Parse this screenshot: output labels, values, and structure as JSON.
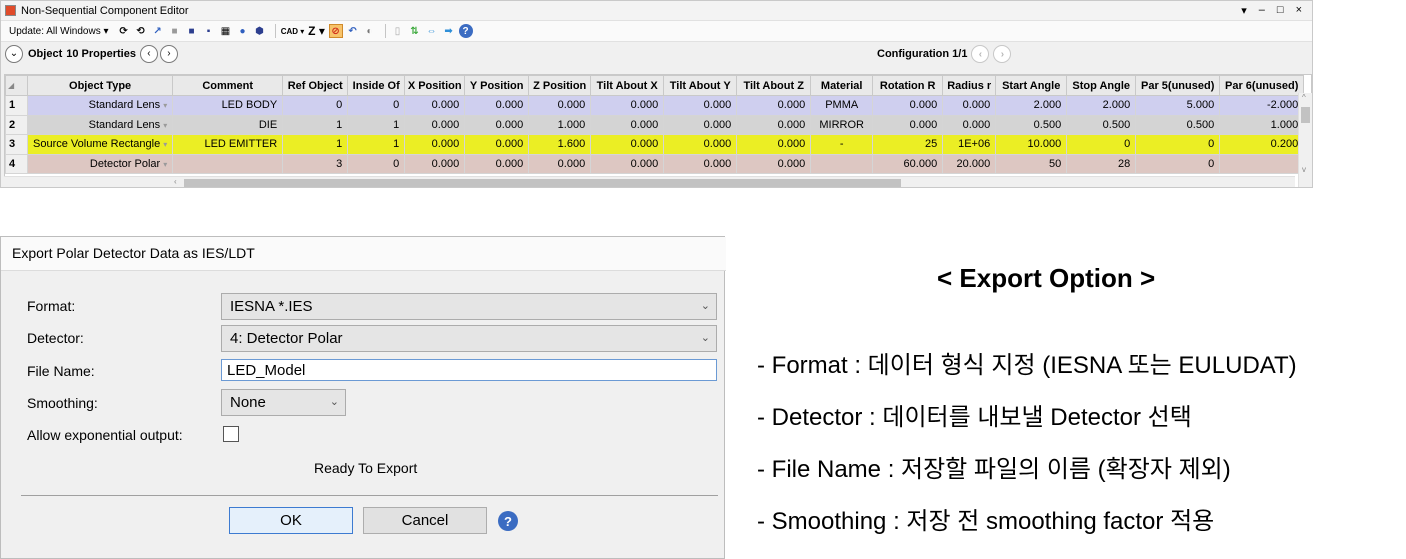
{
  "editor": {
    "title": "Non-Sequential Component Editor",
    "window_controls": [
      "▾",
      "–",
      "□",
      "×"
    ],
    "toolbar": {
      "update_label": "Update: All Windows ▾",
      "cad_label": "CAD ▾",
      "z_label": "Z ▾"
    },
    "object_bar": {
      "object_label": "Object",
      "count_label": "10 Properties"
    },
    "configuration_label": "Configuration 1/1",
    "columns": [
      "Object Type",
      "Comment",
      "Ref Object",
      "Inside Of",
      "X Position",
      "Y Position",
      "Z Position",
      "Tilt About X",
      "Tilt About Y",
      "Tilt About Z",
      "Material",
      "Rotation R",
      "Radius r",
      "Start Angle",
      "Stop Angle",
      "Par 5(unused)",
      "Par 6(unused)"
    ],
    "rows": [
      {
        "num": "1",
        "cells": [
          "Standard Lens",
          "LED BODY",
          "0",
          "0",
          "0.000",
          "0.000",
          "0.000",
          "0.000",
          "0.000",
          "0.000",
          "PMMA",
          "0.000",
          "0.000",
          "2.000",
          "2.000",
          "5.000",
          "-2.000"
        ]
      },
      {
        "num": "2",
        "cells": [
          "Standard Lens",
          "DIE",
          "1",
          "1",
          "0.000",
          "0.000",
          "1.000",
          "0.000",
          "0.000",
          "0.000",
          "MIRROR",
          "0.000",
          "0.000",
          "0.500",
          "0.500",
          "0.500",
          "1.000"
        ]
      },
      {
        "num": "3",
        "cells": [
          "Source Volume Rectangle",
          "LED EMITTER",
          "1",
          "1",
          "0.000",
          "0.000",
          "1.600",
          "0.000",
          "0.000",
          "0.000",
          "-",
          "25",
          "1E+06",
          "10.000",
          "0",
          "0",
          "0.200"
        ]
      },
      {
        "num": "4",
        "cells": [
          "Detector Polar",
          "",
          "3",
          "0",
          "0.000",
          "0.000",
          "0.000",
          "0.000",
          "0.000",
          "0.000",
          "",
          "60.000",
          "20.000",
          "50",
          "28",
          "0",
          ""
        ]
      }
    ]
  },
  "dialog": {
    "title": "Export Polar Detector Data as IES/LDT",
    "format_label": "Format:",
    "format_value": "IESNA *.IES",
    "detector_label": "Detector:",
    "detector_value": "4: Detector Polar",
    "filename_label": "File Name:",
    "filename_value": "LED_Model",
    "smoothing_label": "Smoothing:",
    "smoothing_value": "None",
    "exponential_label": "Allow exponential output:",
    "exponential_checked": false,
    "status": "Ready To Export",
    "ok_label": "OK",
    "cancel_label": "Cancel",
    "help_label": "?"
  },
  "explanation": {
    "title": "< Export Option >",
    "lines": [
      "- Format : 데이터 형식 지정 (IESNA 또는 EULUDAT)",
      "- Detector : 데이터를 내보낼 Detector 선택",
      "- File Name : 저장할 파일의 이름 (확장자 제외)",
      "- Smoothing : 저장 전 smoothing factor 적용"
    ]
  },
  "colors": {
    "row1": "#cfcfef",
    "row2": "#d4d4d4",
    "row3": "#ebee24",
    "row4": "#ddc7c2",
    "help_icon": "#3b6cc2"
  }
}
